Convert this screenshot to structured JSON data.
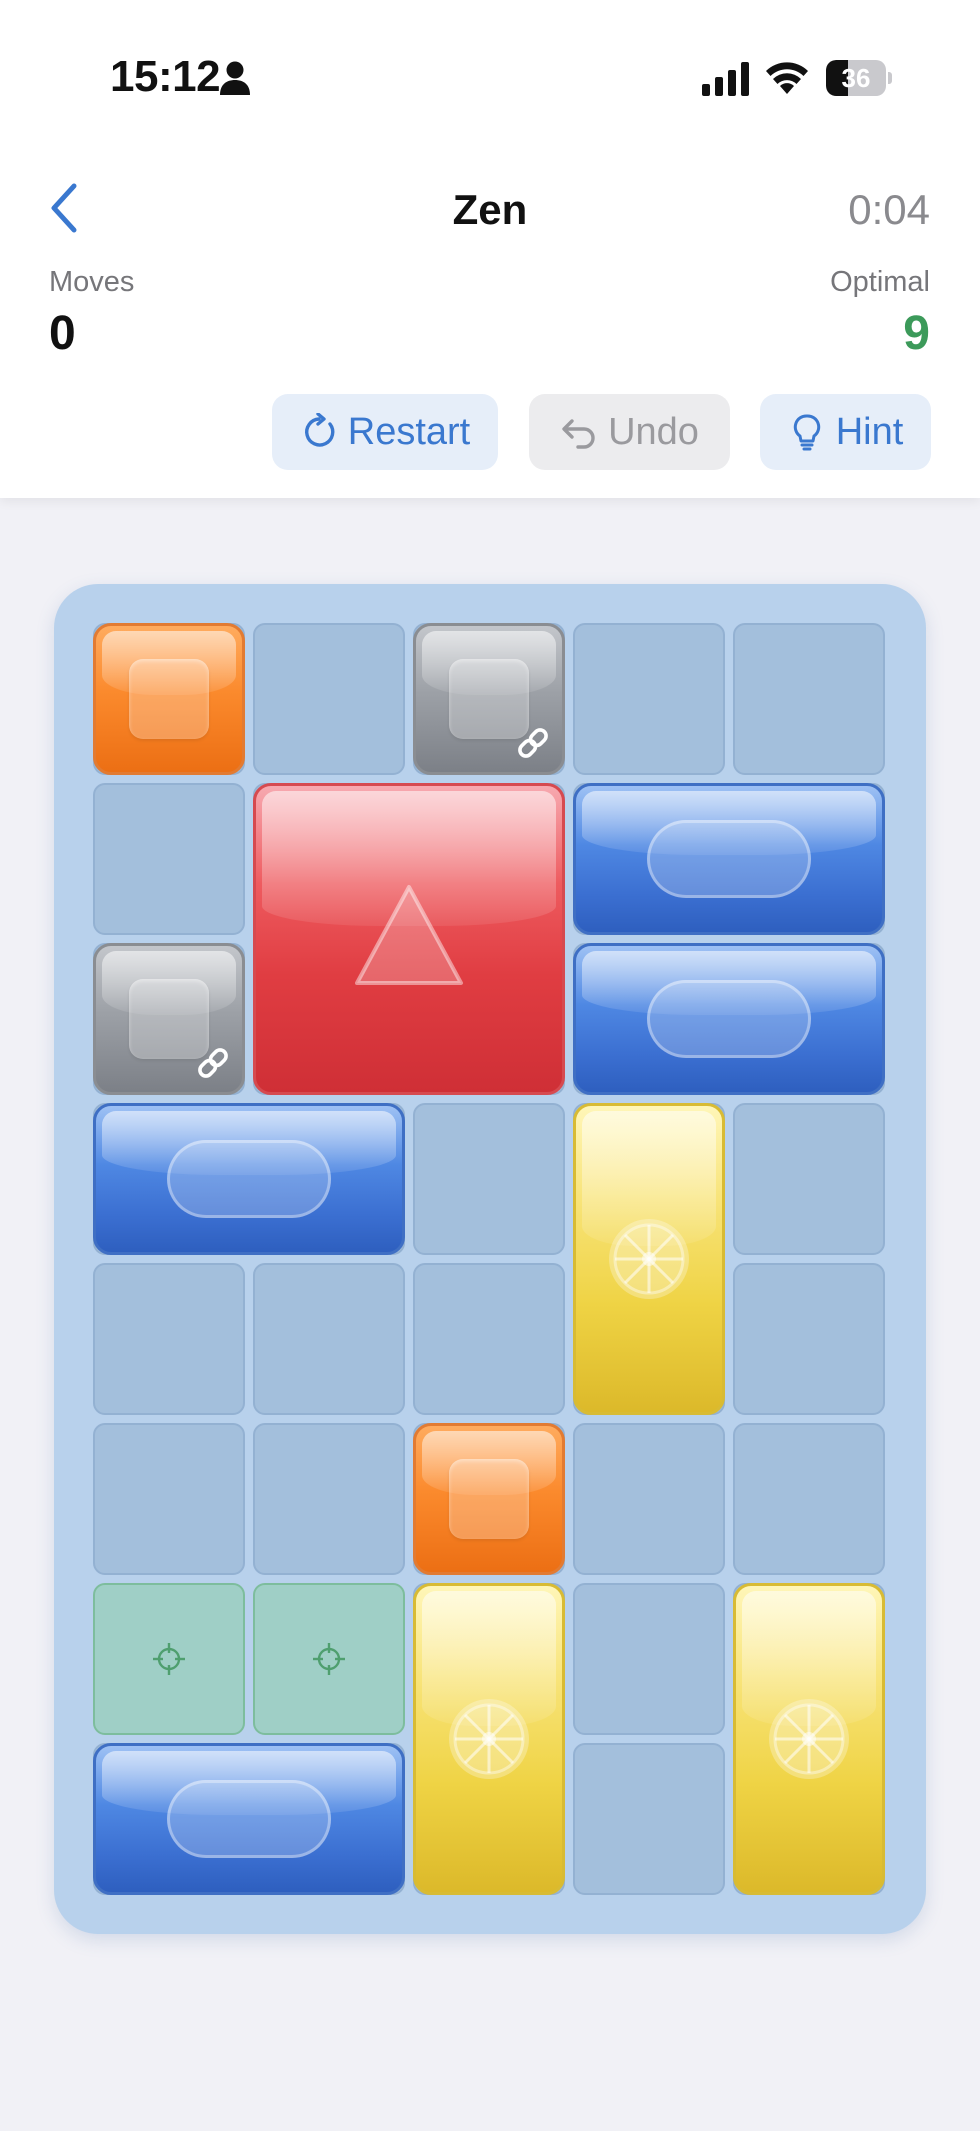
{
  "status_bar": {
    "time": "15:12",
    "battery": "36",
    "battery_level": 0.36,
    "icons": [
      "person-icon",
      "signal-icon",
      "wifi-icon",
      "battery-icon"
    ]
  },
  "header": {
    "back_icon": "chevron-left-icon",
    "title": "Zen",
    "timer": "0:04"
  },
  "stats": {
    "moves_label": "Moves",
    "moves_value": "0",
    "optimal_label": "Optimal",
    "optimal_value": "9"
  },
  "actions": {
    "restart_label": "Restart",
    "undo_label": "Undo",
    "hint_label": "Hint",
    "restart_icon": "restart-icon",
    "undo_icon": "undo-icon",
    "hint_icon": "lightbulb-icon"
  },
  "board": {
    "columns": 5,
    "rows": 8,
    "target_cells": [
      [
        6,
        0
      ],
      [
        6,
        1
      ]
    ],
    "blocks": [
      {
        "id": "orange-1",
        "color": "orange",
        "row": 0,
        "col": 0,
        "w": 1,
        "h": 1,
        "icon": "square"
      },
      {
        "id": "gray-1",
        "color": "gray",
        "row": 0,
        "col": 2,
        "w": 1,
        "h": 1,
        "icon": "square",
        "linked": true
      },
      {
        "id": "red-main",
        "color": "red",
        "row": 1,
        "col": 1,
        "w": 2,
        "h": 2,
        "icon": "triangle"
      },
      {
        "id": "blue-1",
        "color": "blue",
        "row": 1,
        "col": 3,
        "w": 2,
        "h": 1,
        "icon": "pill"
      },
      {
        "id": "gray-2",
        "color": "gray",
        "row": 2,
        "col": 0,
        "w": 1,
        "h": 1,
        "icon": "square",
        "linked": true
      },
      {
        "id": "blue-2",
        "color": "blue",
        "row": 2,
        "col": 3,
        "w": 2,
        "h": 1,
        "icon": "pill"
      },
      {
        "id": "blue-3",
        "color": "blue",
        "row": 3,
        "col": 0,
        "w": 2,
        "h": 1,
        "icon": "pill"
      },
      {
        "id": "yellow-1",
        "color": "yellow",
        "row": 3,
        "col": 3,
        "w": 1,
        "h": 2,
        "icon": "wheel"
      },
      {
        "id": "orange-2",
        "color": "orange",
        "row": 5,
        "col": 2,
        "w": 1,
        "h": 1,
        "icon": "square"
      },
      {
        "id": "yellow-2",
        "color": "yellow",
        "row": 6,
        "col": 2,
        "w": 1,
        "h": 2,
        "icon": "wheel"
      },
      {
        "id": "yellow-3",
        "color": "yellow",
        "row": 6,
        "col": 4,
        "w": 1,
        "h": 2,
        "icon": "wheel"
      },
      {
        "id": "blue-4",
        "color": "blue",
        "row": 7,
        "col": 0,
        "w": 2,
        "h": 1,
        "icon": "pill"
      }
    ]
  }
}
